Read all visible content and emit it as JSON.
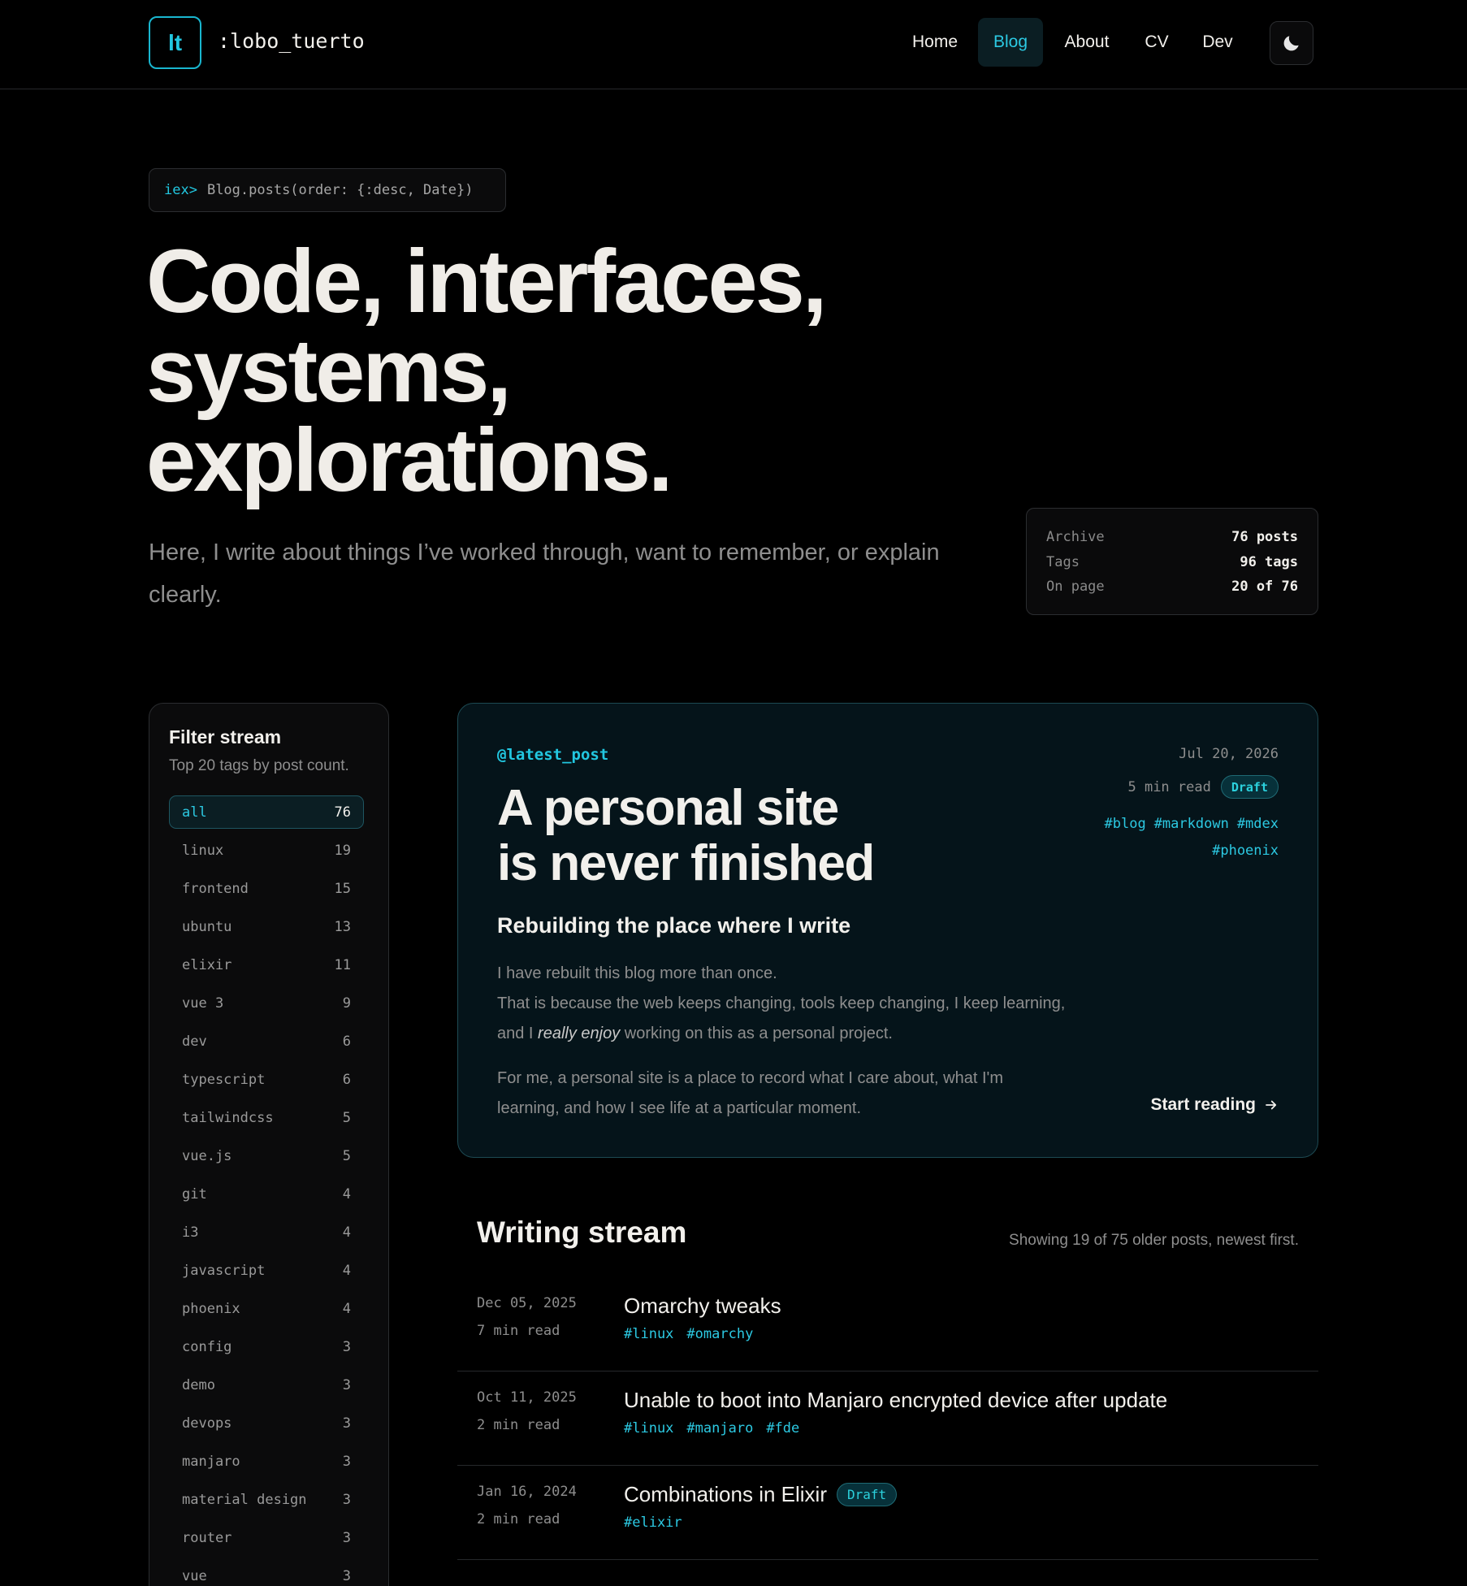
{
  "header": {
    "logo_text": "lt",
    "site_name": ":lobo_tuerto",
    "nav": [
      {
        "label": "Home",
        "active": false
      },
      {
        "label": "Blog",
        "active": true
      },
      {
        "label": "About",
        "active": false
      },
      {
        "label": "CV",
        "active": false
      },
      {
        "label": "Dev",
        "active": false
      }
    ],
    "theme_icon": "moon-icon"
  },
  "hero": {
    "prompt": "iex>",
    "command": "Blog.posts(order: {:desc, Date})",
    "title_lines": [
      "Code, interfaces,",
      "systems,",
      "explorations."
    ],
    "subtitle": "Here, I write about things I’ve worked through, want to remember, or explain clearly."
  },
  "stats": [
    {
      "label": "Archive",
      "value": "76 posts"
    },
    {
      "label": "Tags",
      "value": "96 tags"
    },
    {
      "label": "On page",
      "value": "20 of 76"
    }
  ],
  "filter": {
    "title": "Filter stream",
    "subtitle": "Top 20 tags by post count.",
    "tags": [
      {
        "name": "all",
        "count": "76",
        "active": true
      },
      {
        "name": "linux",
        "count": "19"
      },
      {
        "name": "frontend",
        "count": "15"
      },
      {
        "name": "ubuntu",
        "count": "13"
      },
      {
        "name": "elixir",
        "count": "11"
      },
      {
        "name": "vue 3",
        "count": "9"
      },
      {
        "name": "dev",
        "count": "6"
      },
      {
        "name": "typescript",
        "count": "6"
      },
      {
        "name": "tailwindcss",
        "count": "5"
      },
      {
        "name": "vue.js",
        "count": "5"
      },
      {
        "name": "git",
        "count": "4"
      },
      {
        "name": "i3",
        "count": "4"
      },
      {
        "name": "javascript",
        "count": "4"
      },
      {
        "name": "phoenix",
        "count": "4"
      },
      {
        "name": "config",
        "count": "3"
      },
      {
        "name": "demo",
        "count": "3"
      },
      {
        "name": "devops",
        "count": "3"
      },
      {
        "name": "manjaro",
        "count": "3"
      },
      {
        "name": "material design",
        "count": "3"
      },
      {
        "name": "router",
        "count": "3"
      },
      {
        "name": "vue",
        "count": "3"
      }
    ]
  },
  "latest": {
    "kicker": "@latest_post",
    "title_lines": [
      "A personal site",
      "is never finished"
    ],
    "subtitle": "Rebuilding the place where I write",
    "body_line1": "I have rebuilt this blog more than once.",
    "body_line2_pre": "That is because the web keeps changing, tools keep changing, I keep learning, and I ",
    "body_em": "really enjoy",
    "body_line2_post": " working on this as a personal project.",
    "body_para2": "For me, a personal site is a place to record what I care about, what I'm learning, and how I see life at a particular moment.",
    "date": "Jul 20, 2026",
    "read_time": "5 min read",
    "badge": "Draft",
    "tags": [
      "#blog",
      "#markdown",
      "#mdex",
      "#phoenix"
    ],
    "cta": "Start reading"
  },
  "stream": {
    "title": "Writing stream",
    "summary": "Showing 19 of 75 older posts, newest first.",
    "posts": [
      {
        "date": "Dec 05, 2025",
        "read": "7 min read",
        "title": "Omarchy tweaks",
        "draft": false,
        "tags": [
          "#linux",
          "#omarchy"
        ]
      },
      {
        "date": "Oct 11, 2025",
        "read": "2 min read",
        "title": "Unable to boot into Manjaro encrypted device after update",
        "draft": false,
        "tags": [
          "#linux",
          "#manjaro",
          "#fde"
        ]
      },
      {
        "date": "Jan 16, 2024",
        "read": "2 min read",
        "title": "Combinations in Elixir",
        "draft": true,
        "badge": "Draft",
        "tags": [
          "#elixir"
        ]
      }
    ]
  }
}
